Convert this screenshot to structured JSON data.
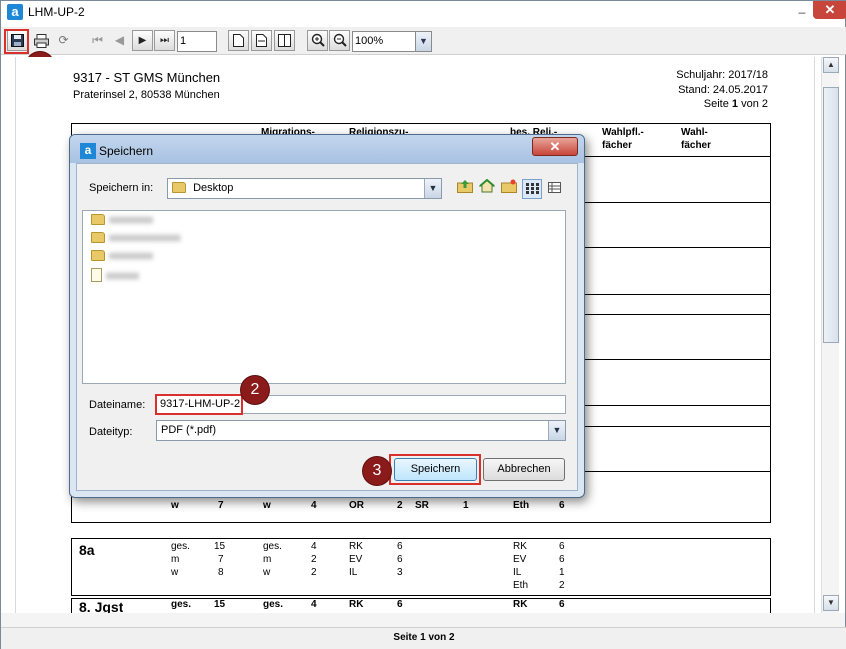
{
  "window": {
    "title": "LHM-UP-2",
    "app_icon": "a",
    "minimize": "_",
    "close": "✕"
  },
  "toolbar": {
    "page_value": "1",
    "zoom_value": "100%"
  },
  "report": {
    "school_name": "9317 - ST GMS München",
    "address": "Praterinsel 2, 80538 München",
    "schuljahr": "Schuljahr: 2017/18",
    "stand": "Stand: 24.05.2017",
    "seite_prefix": "Seite ",
    "seite_num": "1",
    "seite_suffix": " von 2",
    "headers": {
      "migrations": "Migrations-",
      "religion": "Religionszu-",
      "bes_reli": "bes. Reli.-",
      "wahlpfl": "Wahlpfl.-",
      "wahlpfl2": "fächer",
      "wahl": "Wahl-",
      "wahl2": "fächer"
    },
    "row_partial": [
      "w",
      "7",
      "w",
      "4",
      "OR",
      "2",
      "SR",
      "1",
      "Eth",
      "6"
    ],
    "class_8a": {
      "name": "8a",
      "col1": [
        "ges.",
        "m",
        "w"
      ],
      "col2": [
        "15",
        "7",
        "8"
      ],
      "col3": [
        "ges.",
        "m",
        "w"
      ],
      "col4": [
        "4",
        "2",
        "2"
      ],
      "col5": [
        "RK",
        "EV",
        "IL"
      ],
      "col6": [
        "6",
        "6",
        "3"
      ],
      "col7": [
        "RK",
        "EV",
        "IL",
        "Eth"
      ],
      "col8": [
        "6",
        "6",
        "1",
        "2"
      ]
    },
    "class_8jgst": {
      "name": "8. Jgst",
      "values": [
        "ges.",
        "15",
        "ges.",
        "4",
        "RK",
        "6",
        "RK",
        "6"
      ]
    }
  },
  "statusbar": "Seite 1 von 2",
  "dialog": {
    "title": "Speichern",
    "close": "✕",
    "save_in_label": "Speichern in:",
    "save_in_value": "Desktop",
    "files": [
      {
        "type": "folder",
        "name": "xxxxxxxx"
      },
      {
        "type": "folder",
        "name": "xxxxxxxxxxxxx"
      },
      {
        "type": "folder",
        "name": "xxxxxxxx"
      },
      {
        "type": "file",
        "name": "xxxxxx"
      }
    ],
    "filename_label": "Dateiname:",
    "filename_value": "9317-LHM-UP-2",
    "filetype_label": "Dateityp:",
    "filetype_value": "PDF (*.pdf)",
    "save_button": "Speichern",
    "cancel_button": "Abbrechen"
  },
  "markers": [
    "1",
    "2",
    "3"
  ],
  "colors": {
    "highlight": "#d9302c",
    "marker": "#8b1a1a"
  }
}
